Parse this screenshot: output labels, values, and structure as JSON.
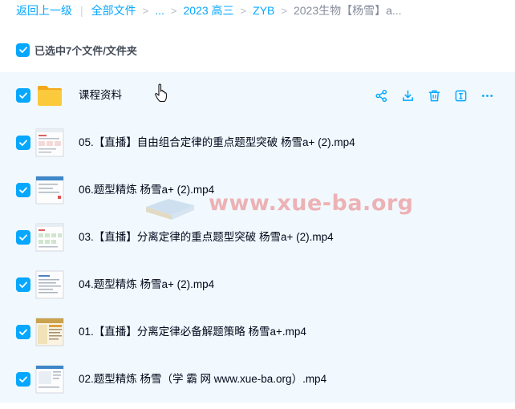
{
  "breadcrumb": {
    "back": "返回上一级",
    "all_files": "全部文件",
    "ellipsis": "...",
    "folder1": "2023 高三",
    "folder2": "ZYB",
    "current": "2023生物【杨雪】a..."
  },
  "selection": {
    "label": "已选中7个文件/文件夹"
  },
  "files": [
    {
      "name": "课程资料",
      "type": "folder"
    },
    {
      "name": "05.【直播】自由组合定律的重点题型突破 杨雪a+ (2).mp4",
      "type": "video"
    },
    {
      "name": "06.题型精炼 杨雪a+ (2).mp4",
      "type": "video"
    },
    {
      "name": "03.【直播】分离定律的重点题型突破 杨雪a+ (2).mp4",
      "type": "video"
    },
    {
      "name": "04.题型精炼 杨雪a+ (2).mp4",
      "type": "video"
    },
    {
      "name": "01.【直播】分离定律必备解题策略 杨雪a+.mp4",
      "type": "video"
    },
    {
      "name": "02.题型精炼 杨雪（学 霸 网 www.xue-ba.org）.mp4",
      "type": "video"
    }
  ],
  "watermark": "www.xue-ba.org",
  "colors": {
    "accent": "#06a7ff",
    "list_bg": "#f1f9fe",
    "folder": "#fbbf24"
  },
  "icons": [
    "share-icon",
    "download-icon",
    "delete-icon",
    "rename-icon",
    "more-icon"
  ]
}
